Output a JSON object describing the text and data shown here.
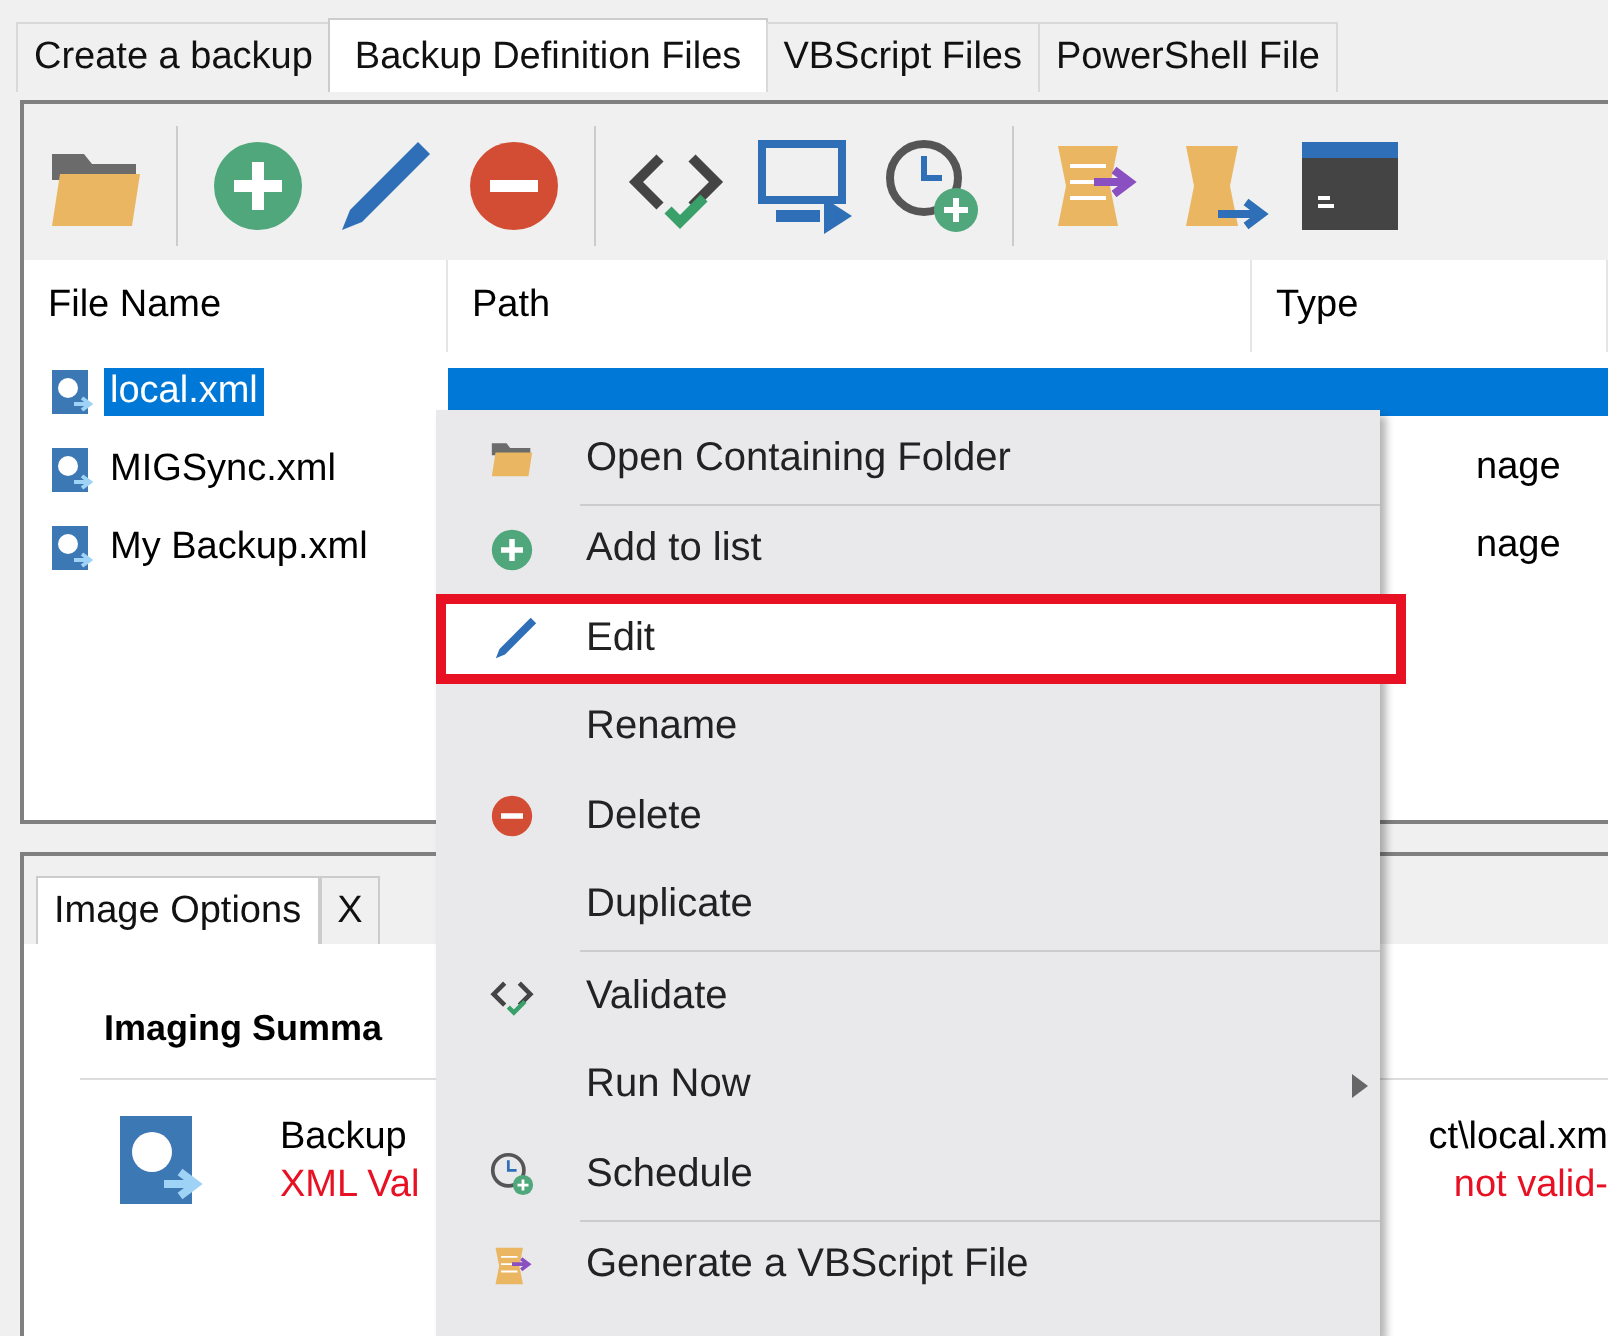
{
  "tabs": [
    {
      "label": "Create a backup",
      "selected": false
    },
    {
      "label": "Backup Definition Files",
      "selected": true
    },
    {
      "label": "VBScript Files",
      "selected": false
    },
    {
      "label": "PowerShell File",
      "selected": false
    }
  ],
  "table": {
    "columns": [
      "File Name",
      "Path",
      "Type"
    ],
    "rows": [
      {
        "name": "local.xml",
        "type": "",
        "selected": true
      },
      {
        "name": "MIGSync.xml",
        "type": "nage",
        "selected": false
      },
      {
        "name": "My Backup.xml",
        "type": "nage",
        "selected": false
      }
    ]
  },
  "bottom_tabs": [
    {
      "label": "Image Options",
      "selected": true
    },
    {
      "label": "X",
      "selected": false
    }
  ],
  "summary": {
    "heading": "Imaging Summa",
    "line_1": "Backup",
    "line_1_right": "ct\\local.xm",
    "line_2": "XML Val",
    "line_2_right": "not valid-"
  },
  "context_menu": [
    {
      "kind": "item",
      "label": "Open Containing Folder",
      "highlighted": false,
      "submenu": false
    },
    {
      "kind": "separator"
    },
    {
      "kind": "item",
      "label": "Add to list",
      "highlighted": false,
      "submenu": false
    },
    {
      "kind": "item",
      "label": "Edit",
      "highlighted": true,
      "submenu": false
    },
    {
      "kind": "item",
      "label": "Rename",
      "highlighted": false,
      "submenu": false
    },
    {
      "kind": "item",
      "label": "Delete",
      "highlighted": false,
      "submenu": false
    },
    {
      "kind": "item",
      "label": "Duplicate",
      "highlighted": false,
      "submenu": false
    },
    {
      "kind": "separator"
    },
    {
      "kind": "item",
      "label": "Validate",
      "highlighted": false,
      "submenu": false
    },
    {
      "kind": "item",
      "label": "Run Now",
      "highlighted": false,
      "submenu": true
    },
    {
      "kind": "item",
      "label": "Schedule",
      "highlighted": false,
      "submenu": false
    },
    {
      "kind": "separator"
    },
    {
      "kind": "item",
      "label": "Generate a VBScript File",
      "highlighted": false,
      "submenu": false
    }
  ]
}
